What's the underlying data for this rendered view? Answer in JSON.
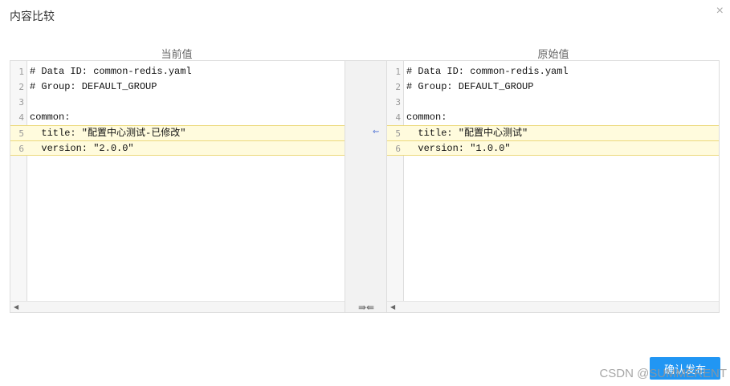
{
  "dialog": {
    "title": "内容比较",
    "close_symbol": "×"
  },
  "left_pane": {
    "header": "当前值",
    "lines": [
      {
        "num": "1",
        "text": "# Data ID: common-redis.yaml",
        "changed": false
      },
      {
        "num": "2",
        "text": "# Group: DEFAULT_GROUP",
        "changed": false
      },
      {
        "num": "3",
        "text": "",
        "changed": false
      },
      {
        "num": "4",
        "text": "common:",
        "changed": false
      },
      {
        "num": "5",
        "text": "  title: \"配置中心测试-已修改\"",
        "changed": true
      },
      {
        "num": "6",
        "text": "  version: \"2.0.0\"",
        "changed": true
      }
    ]
  },
  "right_pane": {
    "header": "原始值",
    "lines": [
      {
        "num": "1",
        "text": "# Data ID: common-redis.yaml",
        "changed": false
      },
      {
        "num": "2",
        "text": "# Group: DEFAULT_GROUP",
        "changed": false
      },
      {
        "num": "3",
        "text": "",
        "changed": false
      },
      {
        "num": "4",
        "text": "common:",
        "changed": false
      },
      {
        "num": "5",
        "text": "  title: \"配置中心测试\"",
        "changed": true
      },
      {
        "num": "6",
        "text": "  version: \"1.0.0\"",
        "changed": true
      }
    ]
  },
  "merge_controls": {
    "revert_symbol": "⇜",
    "merge_all_symbol": "⇛⇚",
    "scroll_left_symbol": "◀"
  },
  "footer": {
    "confirm_label": "确认发布"
  },
  "watermark": "CSDN @SUMMERENT",
  "colors": {
    "accent": "#2196f3",
    "changed_line_bg": "#fffbdd",
    "changed_line_border": "#ecd97a"
  }
}
